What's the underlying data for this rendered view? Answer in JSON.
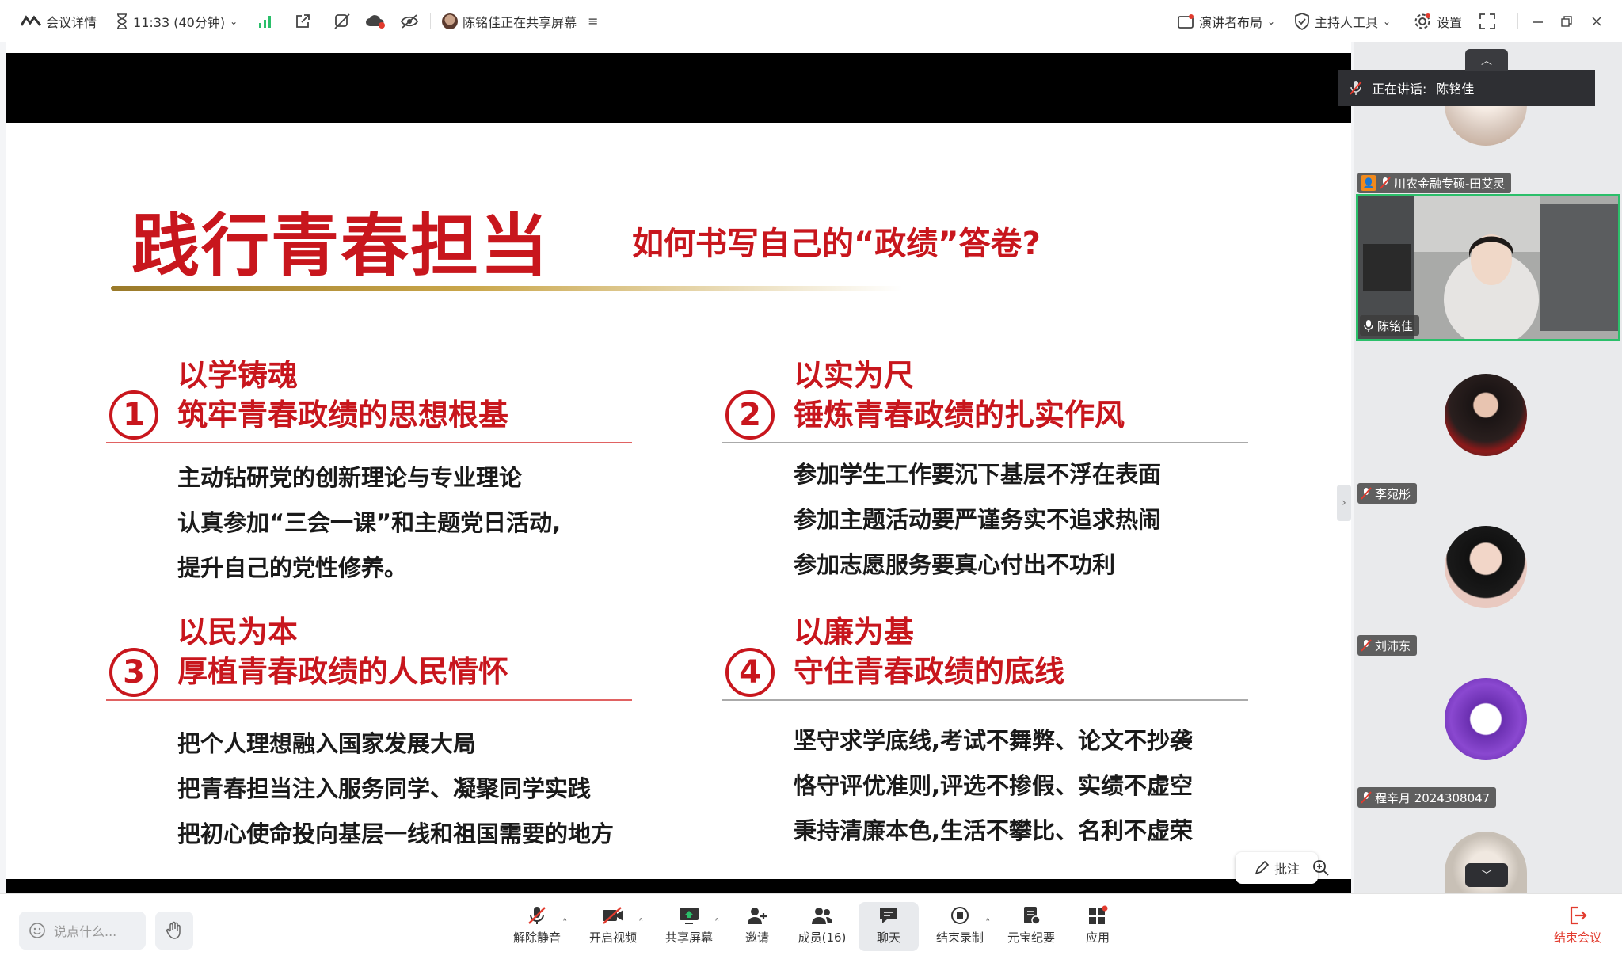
{
  "topbar": {
    "meeting_details": "会议详情",
    "timer": "11:33 (40分钟)",
    "sharing_status": "陈铭佳正在共享屏幕",
    "presenter_layout": "演讲者布局",
    "host_tools": "主持人工具",
    "settings": "设置"
  },
  "slide": {
    "title": "践行青春担当",
    "subtitle": "如何书写自己的“政绩”答卷?",
    "sections": [
      {
        "num": "1",
        "heading1": "以学铸魂",
        "heading2": "筑牢青春政绩的思想根基",
        "bullets": [
          "主动钻研党的创新理论与专业理论",
          "认真参加“三会一课”和主题党日活动,",
          "提升自己的党性修养。"
        ]
      },
      {
        "num": "2",
        "heading1": "以实为尺",
        "heading2": "锤炼青春政绩的扎实作风",
        "bullets": [
          "参加学生工作要沉下基层不浮在表面",
          "参加主题活动要严谨务实不追求热闹",
          "参加志愿服务要真心付出不功利"
        ]
      },
      {
        "num": "3",
        "heading1": "以民为本",
        "heading2": "厚植青春政绩的人民情怀",
        "bullets": [
          "把个人理想融入国家发展大局",
          "把青春担当注入服务同学、凝聚同学实践",
          "把初心使命投向基层一线和祖国需要的地方"
        ]
      },
      {
        "num": "4",
        "heading1": "以廉为基",
        "heading2": "守住青春政绩的底线",
        "bullets": [
          "坚守求学底线,考试不舞弊、论文不抄袭",
          "恪守评优准则,评选不掺假、实绩不虚空",
          "秉持清廉本色,生活不攀比、名利不虚荣"
        ]
      }
    ],
    "annotate_label": "批注"
  },
  "sidebar": {
    "speaking_label": "正在讲话:",
    "speaking_name": "陈铭佳",
    "participants": [
      {
        "name": "川农金融专硕-田艾灵",
        "muted": true,
        "host": true
      },
      {
        "name": "陈铭佳",
        "muted": false,
        "video": true
      },
      {
        "name": "李宛彤",
        "muted": true
      },
      {
        "name": "刘沛东",
        "muted": true
      },
      {
        "name": "程辛月 2024308047",
        "muted": true
      }
    ]
  },
  "bottombar": {
    "say_placeholder": "说点什么...",
    "tools": [
      {
        "id": "unmute",
        "label": "解除静音"
      },
      {
        "id": "video",
        "label": "开启视频"
      },
      {
        "id": "share",
        "label": "共享屏幕"
      },
      {
        "id": "invite",
        "label": "邀请"
      },
      {
        "id": "members",
        "label": "成员(16)"
      },
      {
        "id": "chat",
        "label": "聊天"
      },
      {
        "id": "record",
        "label": "结束录制"
      },
      {
        "id": "yuanbao",
        "label": "元宝纪要"
      },
      {
        "id": "apps",
        "label": "应用"
      }
    ],
    "end_meeting": "结束会议"
  },
  "colors": {
    "accent_red": "#c8161d",
    "active_green": "#2bbf6a",
    "toolbar_bg": "#ffffff"
  }
}
